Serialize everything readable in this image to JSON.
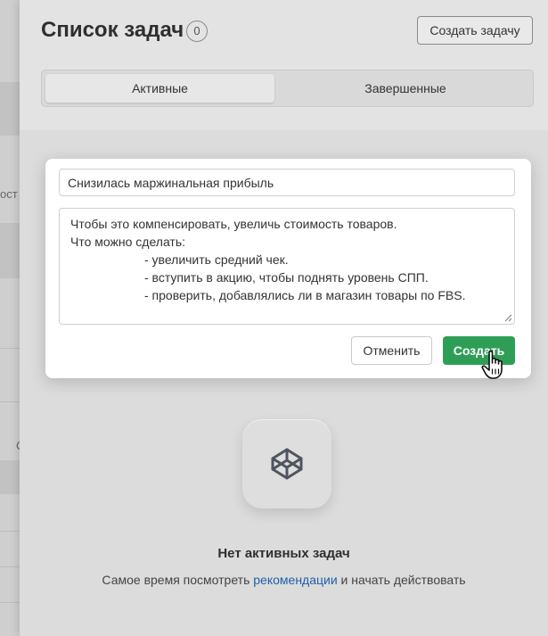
{
  "underlay": {
    "fragment_1": "ост",
    "fragment_2": "С"
  },
  "header": {
    "title": "Список задач",
    "count": "0",
    "create_task_label": "Создать задачу"
  },
  "tabs": [
    {
      "label": "Активные",
      "active": true
    },
    {
      "label": "Завершенные",
      "active": false
    }
  ],
  "modal": {
    "title_value": "Снизилась маржинальная прибыль",
    "description_lines": [
      "Чтобы это компенсировать, увеличь стоимость товаров.",
      "Что можно сделать:",
      "- увеличить средний чек.",
      "- вступить в акцию, чтобы поднять уровень СПП.",
      "- проверить, добавлялись ли в магазин товары по FBS."
    ],
    "cancel_label": "Отменить",
    "create_label": "Создать"
  },
  "empty_state": {
    "icon": "codepen-cube-icon",
    "title": "Нет активных задач",
    "text_before": "Самое время посмотреть ",
    "link_text": "рекомендации",
    "text_after": " и начать действовать"
  },
  "colors": {
    "accent_green": "#2e9e57",
    "link_blue": "#1f5fa8"
  }
}
